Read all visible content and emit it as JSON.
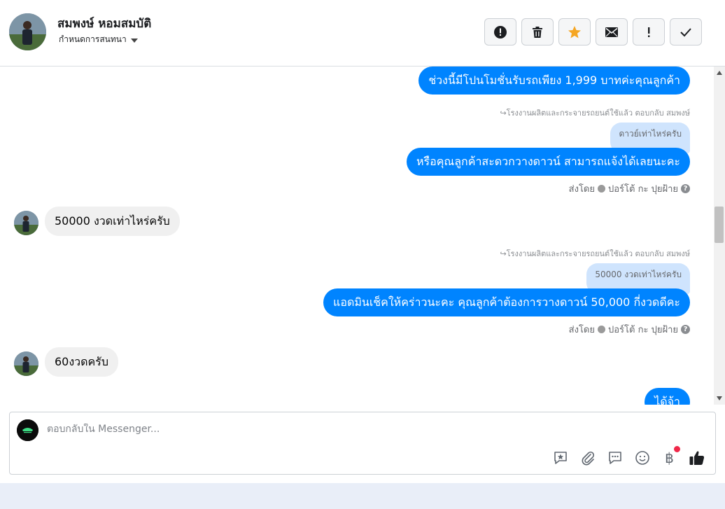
{
  "header": {
    "contact_name": "สมพงษ์ หอมสมบัติ",
    "assign_label": "กำหนดการสนทนา",
    "toolbar": [
      {
        "name": "report-spam-button",
        "icon": "alert-circle-icon"
      },
      {
        "name": "delete-button",
        "icon": "trash-icon"
      },
      {
        "name": "star-button",
        "icon": "star-icon",
        "color": "#f5a623"
      },
      {
        "name": "mark-unread-button",
        "icon": "envelope-icon"
      },
      {
        "name": "follow-up-button",
        "icon": "exclamation-icon"
      },
      {
        "name": "mark-done-button",
        "icon": "checkmark-icon"
      }
    ]
  },
  "messages": {
    "m1": {
      "text": "ช่วงนี้มีโปนโมชั่นรับรถเพียง 1,999 บาทค่ะคุณลูกค้า"
    },
    "m2": {
      "reply_meta": "โรงงานผลิตและกระจายรถยนต์ใช้แล้ว ตอบกลับ สมพงษ์",
      "quote": "ดาวย์เท่าไหร่ครับ",
      "text": "หรือคุณลูกค้าสะดวกวางดาวน์ สามารถแจ้งได้เลยนะคะ",
      "sent_by_prefix": "ส่งโดย",
      "sent_by_name": "ปอร์โต้ กะ ปุยฝ้าย"
    },
    "m3": {
      "text": "50000   งวดเท่าไหร่ครับ"
    },
    "m4": {
      "reply_meta": "โรงงานผลิตและกระจายรถยนต์ใช้แล้ว ตอบกลับ สมพงษ์",
      "quote": "50000 งวดเท่าไหร่ครับ",
      "text": "แอดมินเช็คให้คร่าวนะคะ คุณลูกค้าต้องการวางดาวน์ 50,000  กี่งวดดีคะ",
      "sent_by_prefix": "ส่งโดย",
      "sent_by_name": "ปอร์โต้ กะ ปุยฝ้าย"
    },
    "m5": {
      "text": "60งวดครับ"
    },
    "m6": {
      "text": "ได้จ้า"
    }
  },
  "composer": {
    "placeholder": "ตอบกลับใน Messenger...",
    "icons": [
      "saved-reply-icon",
      "attachment-icon",
      "quick-reply-icon",
      "emoji-icon",
      "baht-payment-icon",
      "thumbs-up-icon"
    ],
    "baht_symbol": "฿"
  },
  "colors": {
    "accent": "#0084ff",
    "incoming": "#f0f0f0",
    "quote": "#cfe4fd"
  }
}
